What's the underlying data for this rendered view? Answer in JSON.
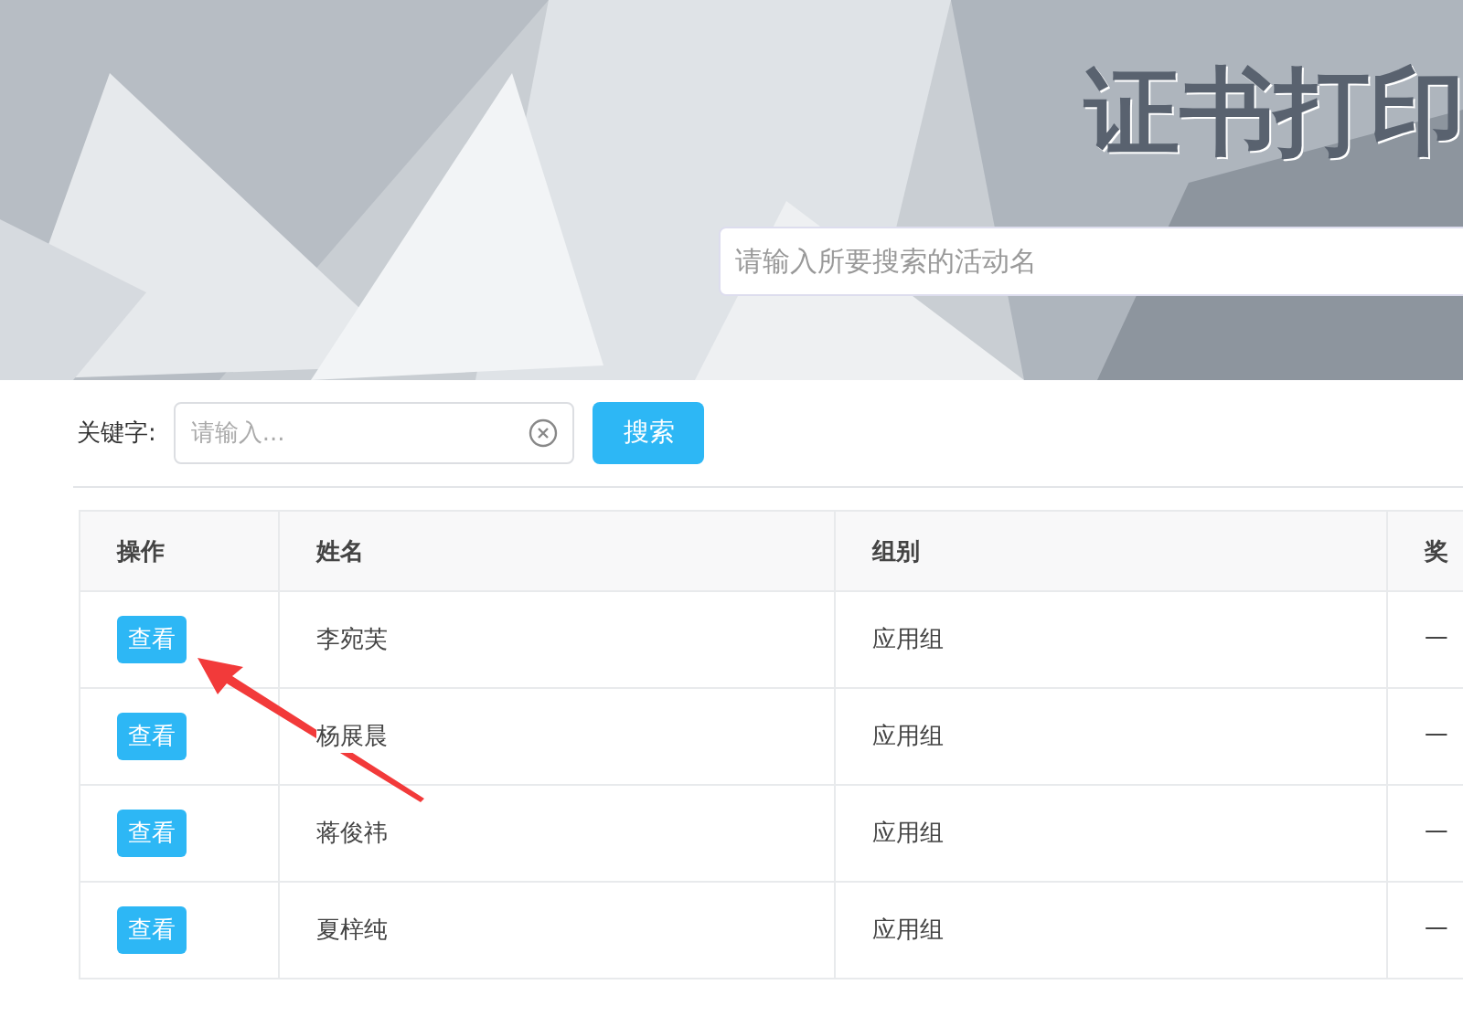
{
  "banner": {
    "title": "证书打印",
    "search": {
      "placeholder": "请输入所要搜索的活动名"
    }
  },
  "filter": {
    "label": "关键字:",
    "input": {
      "placeholder": "请输入..."
    },
    "button": "搜索"
  },
  "table": {
    "columns": [
      "操作",
      "姓名",
      "组别",
      "奖"
    ],
    "rows": [
      {
        "action": "查看",
        "name": "李宛芙",
        "group": "应用组",
        "award": "一"
      },
      {
        "action": "查看",
        "name": "杨展晨",
        "group": "应用组",
        "award": "一"
      },
      {
        "action": "查看",
        "name": "蒋俊祎",
        "group": "应用组",
        "award": "一"
      },
      {
        "action": "查看",
        "name": "夏梓纯",
        "group": "应用组",
        "award": "一"
      }
    ]
  }
}
